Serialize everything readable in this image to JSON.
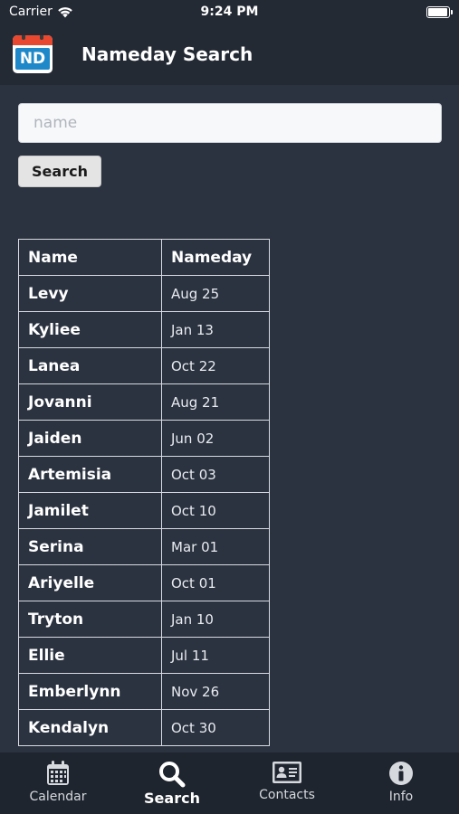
{
  "status_bar": {
    "carrier": "Carrier",
    "time": "9:24 PM",
    "battery_level": 1.0
  },
  "header": {
    "logo_text": "ND",
    "title": "Nameday Search"
  },
  "search": {
    "placeholder": "name",
    "value": "",
    "button_label": "Search"
  },
  "results": {
    "headers": [
      "Name",
      "Nameday"
    ],
    "rows": [
      {
        "name": "Levy",
        "date": "Aug 25"
      },
      {
        "name": "Kyliee",
        "date": "Jan 13"
      },
      {
        "name": "Lanea",
        "date": "Oct 22"
      },
      {
        "name": "Jovanni",
        "date": "Aug 21"
      },
      {
        "name": "Jaiden",
        "date": "Jun 02"
      },
      {
        "name": "Artemisia",
        "date": "Oct 03"
      },
      {
        "name": "Jamilet",
        "date": "Oct 10"
      },
      {
        "name": "Serina",
        "date": "Mar 01"
      },
      {
        "name": "Ariyelle",
        "date": "Oct 01"
      },
      {
        "name": "Tryton",
        "date": "Jan 10"
      },
      {
        "name": "Ellie",
        "date": "Jul 11"
      },
      {
        "name": "Emberlynn",
        "date": "Nov 26"
      },
      {
        "name": "Kendalyn",
        "date": "Oct 30"
      }
    ]
  },
  "tabs": [
    {
      "label": "Calendar",
      "icon": "calendar-icon",
      "active": false
    },
    {
      "label": "Search",
      "icon": "search-icon",
      "active": true
    },
    {
      "label": "Contacts",
      "icon": "contact-card-icon",
      "active": false
    },
    {
      "label": "Info",
      "icon": "info-icon",
      "active": false
    }
  ],
  "colors": {
    "background": "#2b3340",
    "header": "#232a34",
    "tab_bar": "#1f252e",
    "logo_red": "#e8482f",
    "logo_blue": "#1e88c8"
  }
}
